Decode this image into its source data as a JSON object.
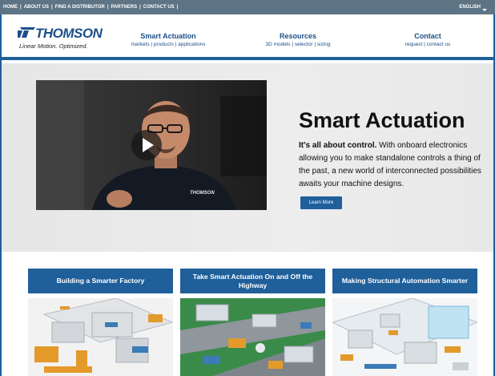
{
  "topbar": {
    "links": [
      "HOME",
      "ABOUT US",
      "FIND A DISTRIBUTOR",
      "PARTNERS",
      "CONTACT US"
    ],
    "separator": "|",
    "language": "ENGLISH"
  },
  "header": {
    "logo_text": "THOMSON",
    "tagline": "Linear Motion. Optimized.",
    "nav": [
      {
        "title": "Smart Actuation",
        "sub": "markets | products | applications"
      },
      {
        "title": "Resources",
        "sub": "3D models | selector | sizing"
      },
      {
        "title": "Contact",
        "sub": "request | contact us"
      }
    ]
  },
  "hero": {
    "video_logo": "THOMSON",
    "title": "Smart Actuation",
    "lead": "It's all about control.",
    "body": " With onboard electronics allowing you to make standalone controls a thing of the past, a new world of interconnected possibilities awaits your machine designs.",
    "button": "Learn More"
  },
  "cards": [
    {
      "title": "Building a Smarter Factory"
    },
    {
      "title": "Take Smart Actuation On and Off the Highway"
    },
    {
      "title": "Making Structural Automation Smarter"
    }
  ],
  "colors": {
    "brand": "#1f5f9a",
    "topbar": "#5e7485",
    "hero_bg": "#e8e8e8"
  }
}
